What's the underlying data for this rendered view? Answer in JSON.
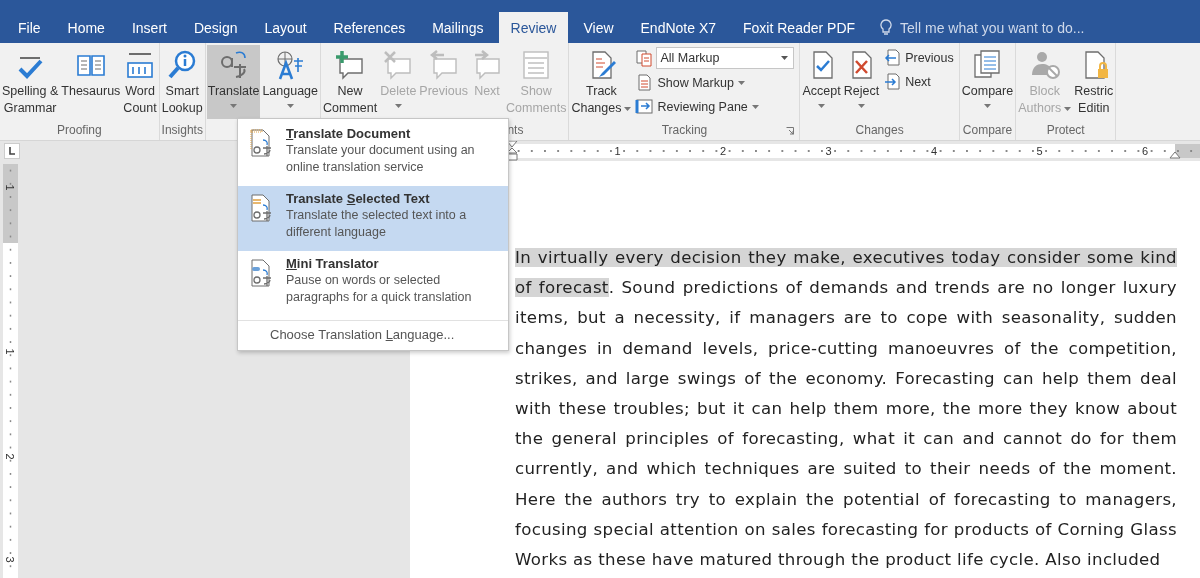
{
  "tabs": [
    {
      "label": "File",
      "selected": false
    },
    {
      "label": "Home",
      "selected": false
    },
    {
      "label": "Insert",
      "selected": false
    },
    {
      "label": "Design",
      "selected": false
    },
    {
      "label": "Layout",
      "selected": false
    },
    {
      "label": "References",
      "selected": false
    },
    {
      "label": "Mailings",
      "selected": false
    },
    {
      "label": "Review",
      "selected": true
    },
    {
      "label": "View",
      "selected": false
    },
    {
      "label": "EndNote X7",
      "selected": false
    },
    {
      "label": "Foxit Reader PDF",
      "selected": false
    }
  ],
  "tell_me": {
    "placeholder": "Tell me what you want to do..."
  },
  "ribbon": {
    "groups": [
      {
        "label": "Proofing",
        "items": [
          {
            "kind": "big",
            "lines": [
              "Spelling &",
              "Grammar"
            ],
            "disabled": false,
            "pressed": false
          },
          {
            "kind": "big",
            "lines": [
              "Thesaurus"
            ],
            "disabled": false,
            "pressed": false
          },
          {
            "kind": "big",
            "lines": [
              "Word",
              "Count"
            ],
            "disabled": false,
            "pressed": false
          }
        ]
      },
      {
        "label": "Insights",
        "items": [
          {
            "kind": "big",
            "lines": [
              "Smart",
              "Lookup"
            ],
            "disabled": false,
            "pressed": false
          }
        ]
      },
      {
        "items": [
          {
            "kind": "big",
            "lines": [
              "Translate"
            ],
            "dropdown": true,
            "disabled": false,
            "pressed": true
          },
          {
            "kind": "big",
            "lines": [
              "Language"
            ],
            "dropdown": true,
            "disabled": false,
            "pressed": false
          }
        ]
      },
      {
        "label": "nts",
        "items": [
          {
            "kind": "big",
            "lines": [
              "New",
              "Comment"
            ],
            "disabled": false,
            "pressed": false
          },
          {
            "kind": "big",
            "lines": [
              "Delete"
            ],
            "dropdown": true,
            "disabled": true,
            "pressed": false
          },
          {
            "kind": "big",
            "lines": [
              "Previous"
            ],
            "disabled": true,
            "pressed": false
          },
          {
            "kind": "big",
            "lines": [
              "Next"
            ],
            "disabled": true,
            "pressed": false
          },
          {
            "kind": "big",
            "lines": [
              "Show",
              "Comments"
            ],
            "disabled": true,
            "pressed": false
          }
        ]
      },
      {
        "label": "Tracking",
        "launcher": true,
        "items": [
          {
            "kind": "big",
            "lines": [
              "Track",
              "Changes"
            ],
            "dropdown": true,
            "disabled": false,
            "pressed": false
          },
          {
            "kind": "stack",
            "items": [
              {
                "kind": "select",
                "value": "All Markup"
              },
              {
                "kind": "small",
                "label": "Show Markup",
                "dropdown": true
              },
              {
                "kind": "small",
                "label": "Reviewing Pane",
                "dropdown": true
              }
            ]
          }
        ]
      },
      {
        "label": "Changes",
        "items": [
          {
            "kind": "big",
            "lines": [
              "Accept"
            ],
            "dropdown": true,
            "disabled": false,
            "pressed": false
          },
          {
            "kind": "big",
            "lines": [
              "Reject"
            ],
            "dropdown": true,
            "disabled": false,
            "pressed": false
          },
          {
            "kind": "stack",
            "items": [
              {
                "kind": "small",
                "label": "Previous"
              },
              {
                "kind": "small",
                "label": "Next"
              }
            ]
          }
        ]
      },
      {
        "label": "Compare",
        "items": [
          {
            "kind": "big",
            "lines": [
              "Compare"
            ],
            "dropdown": true,
            "disabled": false,
            "pressed": false
          }
        ]
      },
      {
        "label": "Protect",
        "items": [
          {
            "kind": "big",
            "lines": [
              "Block",
              "Authors"
            ],
            "dropdown": true,
            "disabled": true,
            "pressed": false
          },
          {
            "kind": "big",
            "lines": [
              "Restric",
              "Editin"
            ],
            "disabled": false,
            "pressed": false
          }
        ]
      }
    ]
  },
  "translate_menu": {
    "items": [
      {
        "title": [
          {
            "text": "T",
            "underlined": true
          },
          {
            "text": "ranslate Document",
            "underlined": false
          }
        ],
        "description": "Translate your document using an online translation service",
        "selected": false
      },
      {
        "title": [
          {
            "text": "Translate ",
            "underlined": false
          },
          {
            "text": "S",
            "underlined": true
          },
          {
            "text": "elected Text",
            "underlined": false
          }
        ],
        "description": "Translate the selected text into a different language",
        "selected": true
      },
      {
        "title": [
          {
            "text": "M",
            "underlined": true
          },
          {
            "text": "ini Translator",
            "underlined": false
          }
        ],
        "description": "Pause on words or selected paragraphs for a quick translation",
        "selected": false
      }
    ],
    "footer": [
      {
        "text": "Choose Translation ",
        "underlined": false
      },
      {
        "text": "L",
        "underlined": true
      },
      {
        "text": "anguage...",
        "underlined": false
      }
    ]
  },
  "horizontal_ruler": {
    "numbers": [
      "1",
      "2",
      "3",
      "4",
      "5",
      "6"
    ]
  },
  "vertical_ruler": {
    "numbers": [
      "1",
      "1",
      "2",
      "3"
    ]
  },
  "document": {
    "selected_text": "In virtually every decision they make, executives today consider some kind of forecast",
    "text": ". Sound predictions of demands and trends are no longer luxury items, but a necessity, if managers are to cope with seasonality, sudden changes in demand levels, price-cutting manoeuvres of the competition, strikes, and large swings of the economy. Forecasting can help them deal with these troubles; but it can help them more, the more they know about the general principles of forecasting, what it can and cannot do for them currently, and which techniques are suited to their needs of the moment. Here the authors try to explain the potential of forecasting to managers, focusing special attention on sales forecasting for products of Corning Glass Works as these have matured through the product life cycle. Also included"
  }
}
